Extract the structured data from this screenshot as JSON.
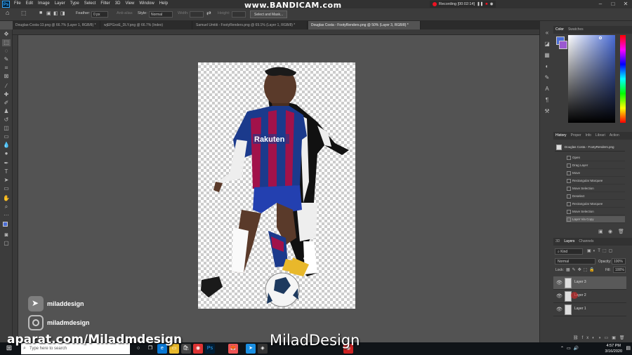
{
  "app": {
    "menus": [
      "File",
      "Edit",
      "Image",
      "Layer",
      "Type",
      "Select",
      "Filter",
      "3D",
      "View",
      "Window",
      "Help"
    ],
    "bandicam": "www.BANDICAM.com",
    "recording": "Recording [00:02:14]"
  },
  "options_bar": {
    "feather_label": "Feather:",
    "feather_value": "0 px",
    "antialias_label": "Anti-alias",
    "style_label": "Style:",
    "style_value": "Normal",
    "width_label": "Width:",
    "height_label": "Height:",
    "select_mask_label": "Select and Mask..."
  },
  "tabs": [
    "Douglas-Costa-13.png @ 66.7% (Layer 1, RGB/8) *",
    "wjEPGxoE_DLY.png @ 66.7% (Index)",
    "Samuel Umtiti - FootyRenders.png @ 69.1% (Layer 1, RGB/8) *",
    "Douglas Costa - FootyRenders.png @ 50% (Layer 3, RGB/8) *"
  ],
  "color_panel": {
    "tabs": [
      "Color",
      "Swatches"
    ],
    "hue_color": "#4a6cd6"
  },
  "history_panel": {
    "tabs": [
      "History",
      "Proper",
      "Info",
      "Librari",
      "Action"
    ],
    "snapshot": "Douglas Costa - FootyRenders.png",
    "items": [
      "Open",
      "Drag Layer",
      "Move",
      "Rectangular Marquee",
      "Move Selection",
      "Deselect",
      "Rectangular Marquee",
      "Move Selection",
      "Layer Via Copy"
    ]
  },
  "layers_panel": {
    "tabs": [
      "3D",
      "Layers",
      "Channels"
    ],
    "kind_value": "Kind",
    "blend_value": "Normal",
    "opacity_label": "Opacity:",
    "opacity_value": "100%",
    "lock_label": "Lock:",
    "fill_label": "Fill:",
    "fill_value": "100%",
    "layers": [
      "Layer 3",
      "Layer 2",
      "Layer 1"
    ]
  },
  "watermark": {
    "telegram": "miladdesign",
    "instagram": "miladmdesign"
  },
  "overlay": {
    "aparat": "aparat.com/Miladmdesign",
    "subtitle": "MiladDesign"
  },
  "taskbar": {
    "search_placeholder": "Type here to search",
    "time": "4:57 PM",
    "date": "3/16/2020"
  },
  "colors": {
    "accent": "#31a8ff",
    "barca_blue": "#1b3a8c",
    "barca_red": "#a1124a"
  }
}
